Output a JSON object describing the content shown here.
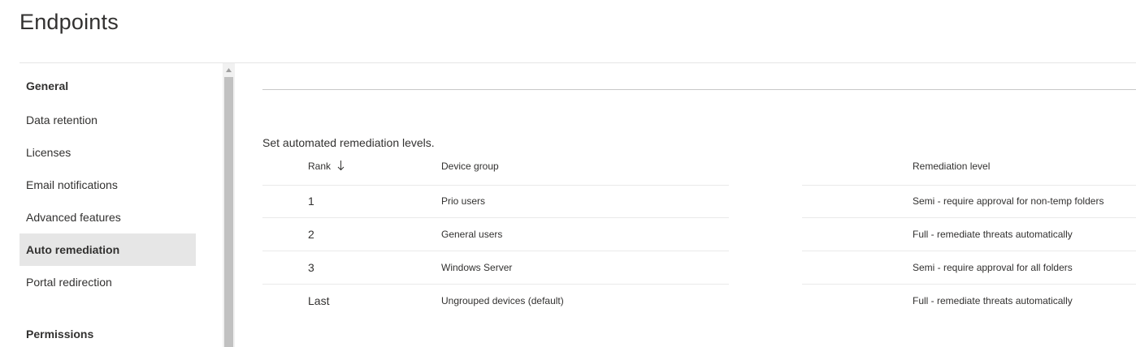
{
  "page": {
    "title": "Endpoints"
  },
  "sidebar": {
    "sections": [
      {
        "heading": "General",
        "items": [
          {
            "label": "Data retention"
          },
          {
            "label": "Licenses"
          },
          {
            "label": "Email notifications"
          },
          {
            "label": "Advanced features"
          },
          {
            "label": "Auto remediation",
            "selected": true
          },
          {
            "label": "Portal redirection"
          }
        ]
      },
      {
        "heading": "Permissions",
        "items": []
      }
    ]
  },
  "main": {
    "description": "Set automated remediation levels.",
    "table": {
      "columns": [
        {
          "label": "Rank",
          "sort": "descending",
          "sort_icon": "arrow-down-icon"
        },
        {
          "label": "Device group"
        },
        {
          "label": "Remediation level"
        }
      ],
      "rows": [
        {
          "rank": "1",
          "device_group": "Prio users",
          "remediation_level": "Semi - require approval for non-temp folders"
        },
        {
          "rank": "2",
          "device_group": "General users",
          "remediation_level": "Full - remediate threats automatically"
        },
        {
          "rank": "3",
          "device_group": "Windows Server",
          "remediation_level": "Semi - require approval for all folders"
        },
        {
          "rank": "Last",
          "device_group": "Ungrouped devices (default)",
          "remediation_level": "Full - remediate threats automatically"
        }
      ]
    }
  },
  "colors": {
    "selected_background": "#e6e6e6",
    "text": "#323130",
    "scrollbar_thumb": "#c1c1c1"
  }
}
